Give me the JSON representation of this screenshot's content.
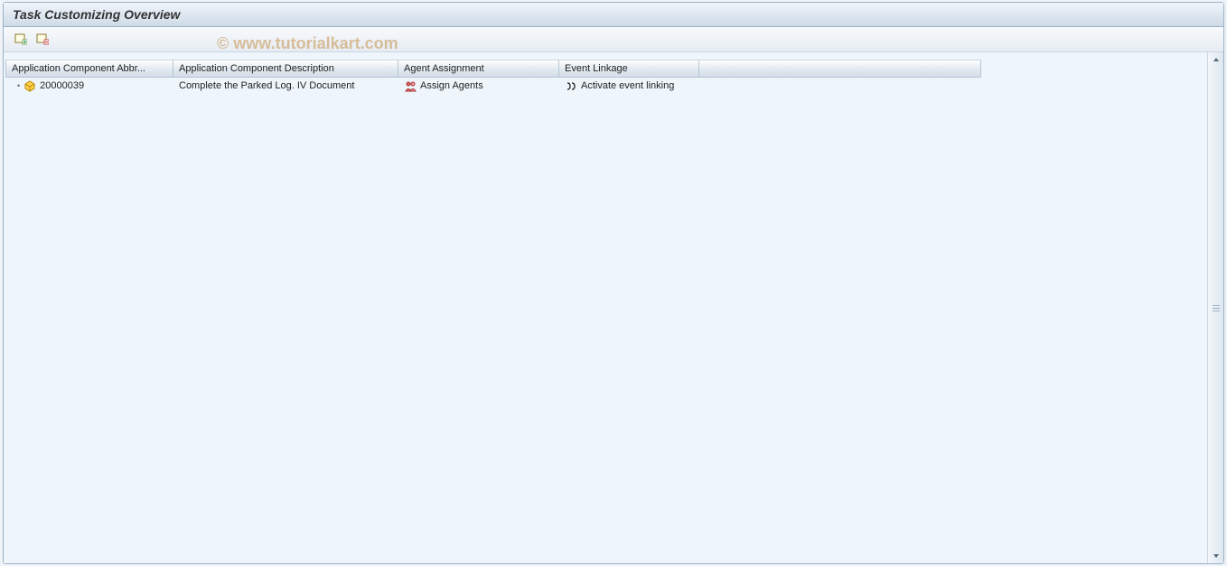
{
  "title": "Task Customizing Overview",
  "columns": {
    "abbr": "Application Component Abbr...",
    "desc": "Application Component Description",
    "agent": "Agent Assignment",
    "event": "Event Linkage"
  },
  "rows": [
    {
      "abbr": "20000039",
      "desc": "Complete the Parked Log. IV Document",
      "agent": "Assign Agents",
      "event": "Activate event linking"
    }
  ],
  "watermark": "© www.tutorialkart.com"
}
